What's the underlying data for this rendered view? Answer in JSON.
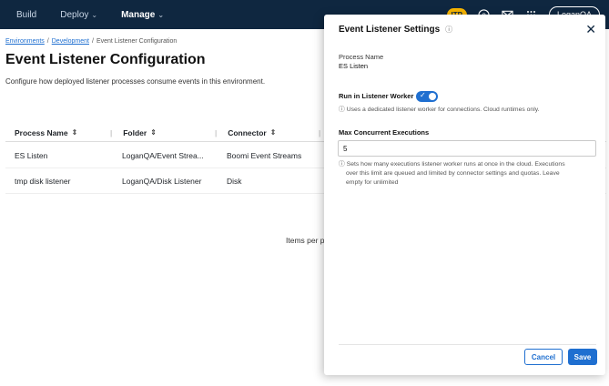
{
  "nav": {
    "items": [
      {
        "label": "Build",
        "has_menu": false
      },
      {
        "label": "Deploy",
        "has_menu": true
      },
      {
        "label": "Manage",
        "has_menu": true
      }
    ],
    "active": "Manage",
    "badge": "ITP",
    "user": "LoganQA",
    "icons": [
      "help-icon",
      "mail-icon",
      "apps-grid-icon"
    ]
  },
  "breadcrumb": {
    "items": [
      "Environments",
      "Development",
      "Event Listener Configuration"
    ],
    "separator": "/"
  },
  "page": {
    "title": "Event Listener Configuration",
    "description": "Configure how deployed listener processes consume events in this environment."
  },
  "table": {
    "columns": [
      "Process Name",
      "Folder",
      "Connector",
      ""
    ],
    "rows": [
      {
        "process": "ES Listen",
        "folder": "LoganQA/Event Strea...",
        "connector": "Boomi Event Streams"
      },
      {
        "process": "tmp disk listener",
        "folder": "LoganQA/Disk Listener",
        "connector": "Disk"
      }
    ],
    "pagination_label": "Items per p"
  },
  "panel": {
    "title": "Event Listener Settings",
    "process_name_label": "Process Name",
    "process_name_value": "ES Listen",
    "worker_label": "Run in Listener Worker",
    "worker_enabled": true,
    "worker_hint": "Uses a dedicated listener worker for connections. Cloud runtimes only.",
    "max_label": "Max Concurrent Executions",
    "max_value": "5",
    "max_hint_line1": "Sets how many executions listener worker runs at once in the cloud. Executions",
    "max_hint_line2": "over this limit are queued and limited by connector settings and quotas. Leave",
    "max_hint_line3": "empty for unlimited",
    "cancel": "Cancel",
    "save": "Save"
  },
  "colors": {
    "topbar": "#0f2740",
    "accent": "#1f6fd0",
    "badge": "#f7b500"
  }
}
